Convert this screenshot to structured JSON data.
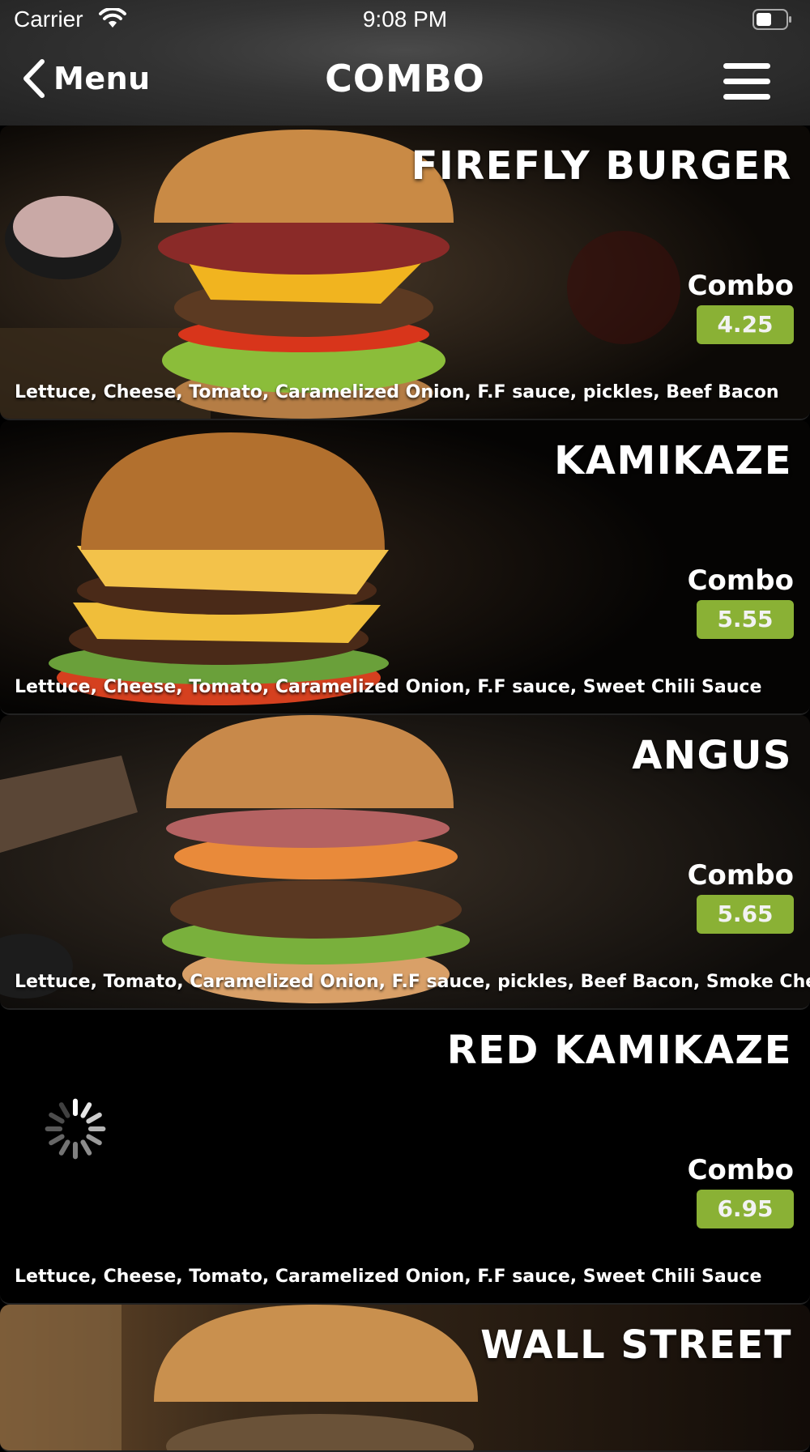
{
  "status": {
    "carrier": "Carrier",
    "time": "9:08 PM"
  },
  "nav": {
    "back_label": "Menu",
    "title": "COMBO"
  },
  "items": [
    {
      "name": "FIREFLY BURGER",
      "combo_label": "Combo",
      "price": "4.25",
      "description": "Lettuce, Cheese, Tomato, Caramelized Onion, F.F sauce, pickles, Beef Bacon"
    },
    {
      "name": "KAMIKAZE",
      "combo_label": "Combo",
      "price": "5.55",
      "description": "Lettuce, Cheese, Tomato, Caramelized Onion, F.F sauce, Sweet Chili Sauce"
    },
    {
      "name": "ANGUS",
      "combo_label": "Combo",
      "price": "5.65",
      "description": "Lettuce, Tomato, Caramelized Onion, F.F sauce, pickles, Beef Bacon, Smoke Cheese"
    },
    {
      "name": "RED KAMIKAZE",
      "combo_label": "Combo",
      "price": "6.95",
      "description": "Lettuce, Cheese, Tomato, Caramelized Onion, F.F sauce, Sweet Chili Sauce"
    },
    {
      "name": "WALL STREET"
    }
  ],
  "colors": {
    "price_badge": "#8ab135",
    "background": "#000000"
  },
  "icons": {
    "back": "chevron-left-icon",
    "menu": "hamburger-icon",
    "wifi": "wifi-icon",
    "battery": "battery-icon",
    "loading": "spinner-icon"
  }
}
